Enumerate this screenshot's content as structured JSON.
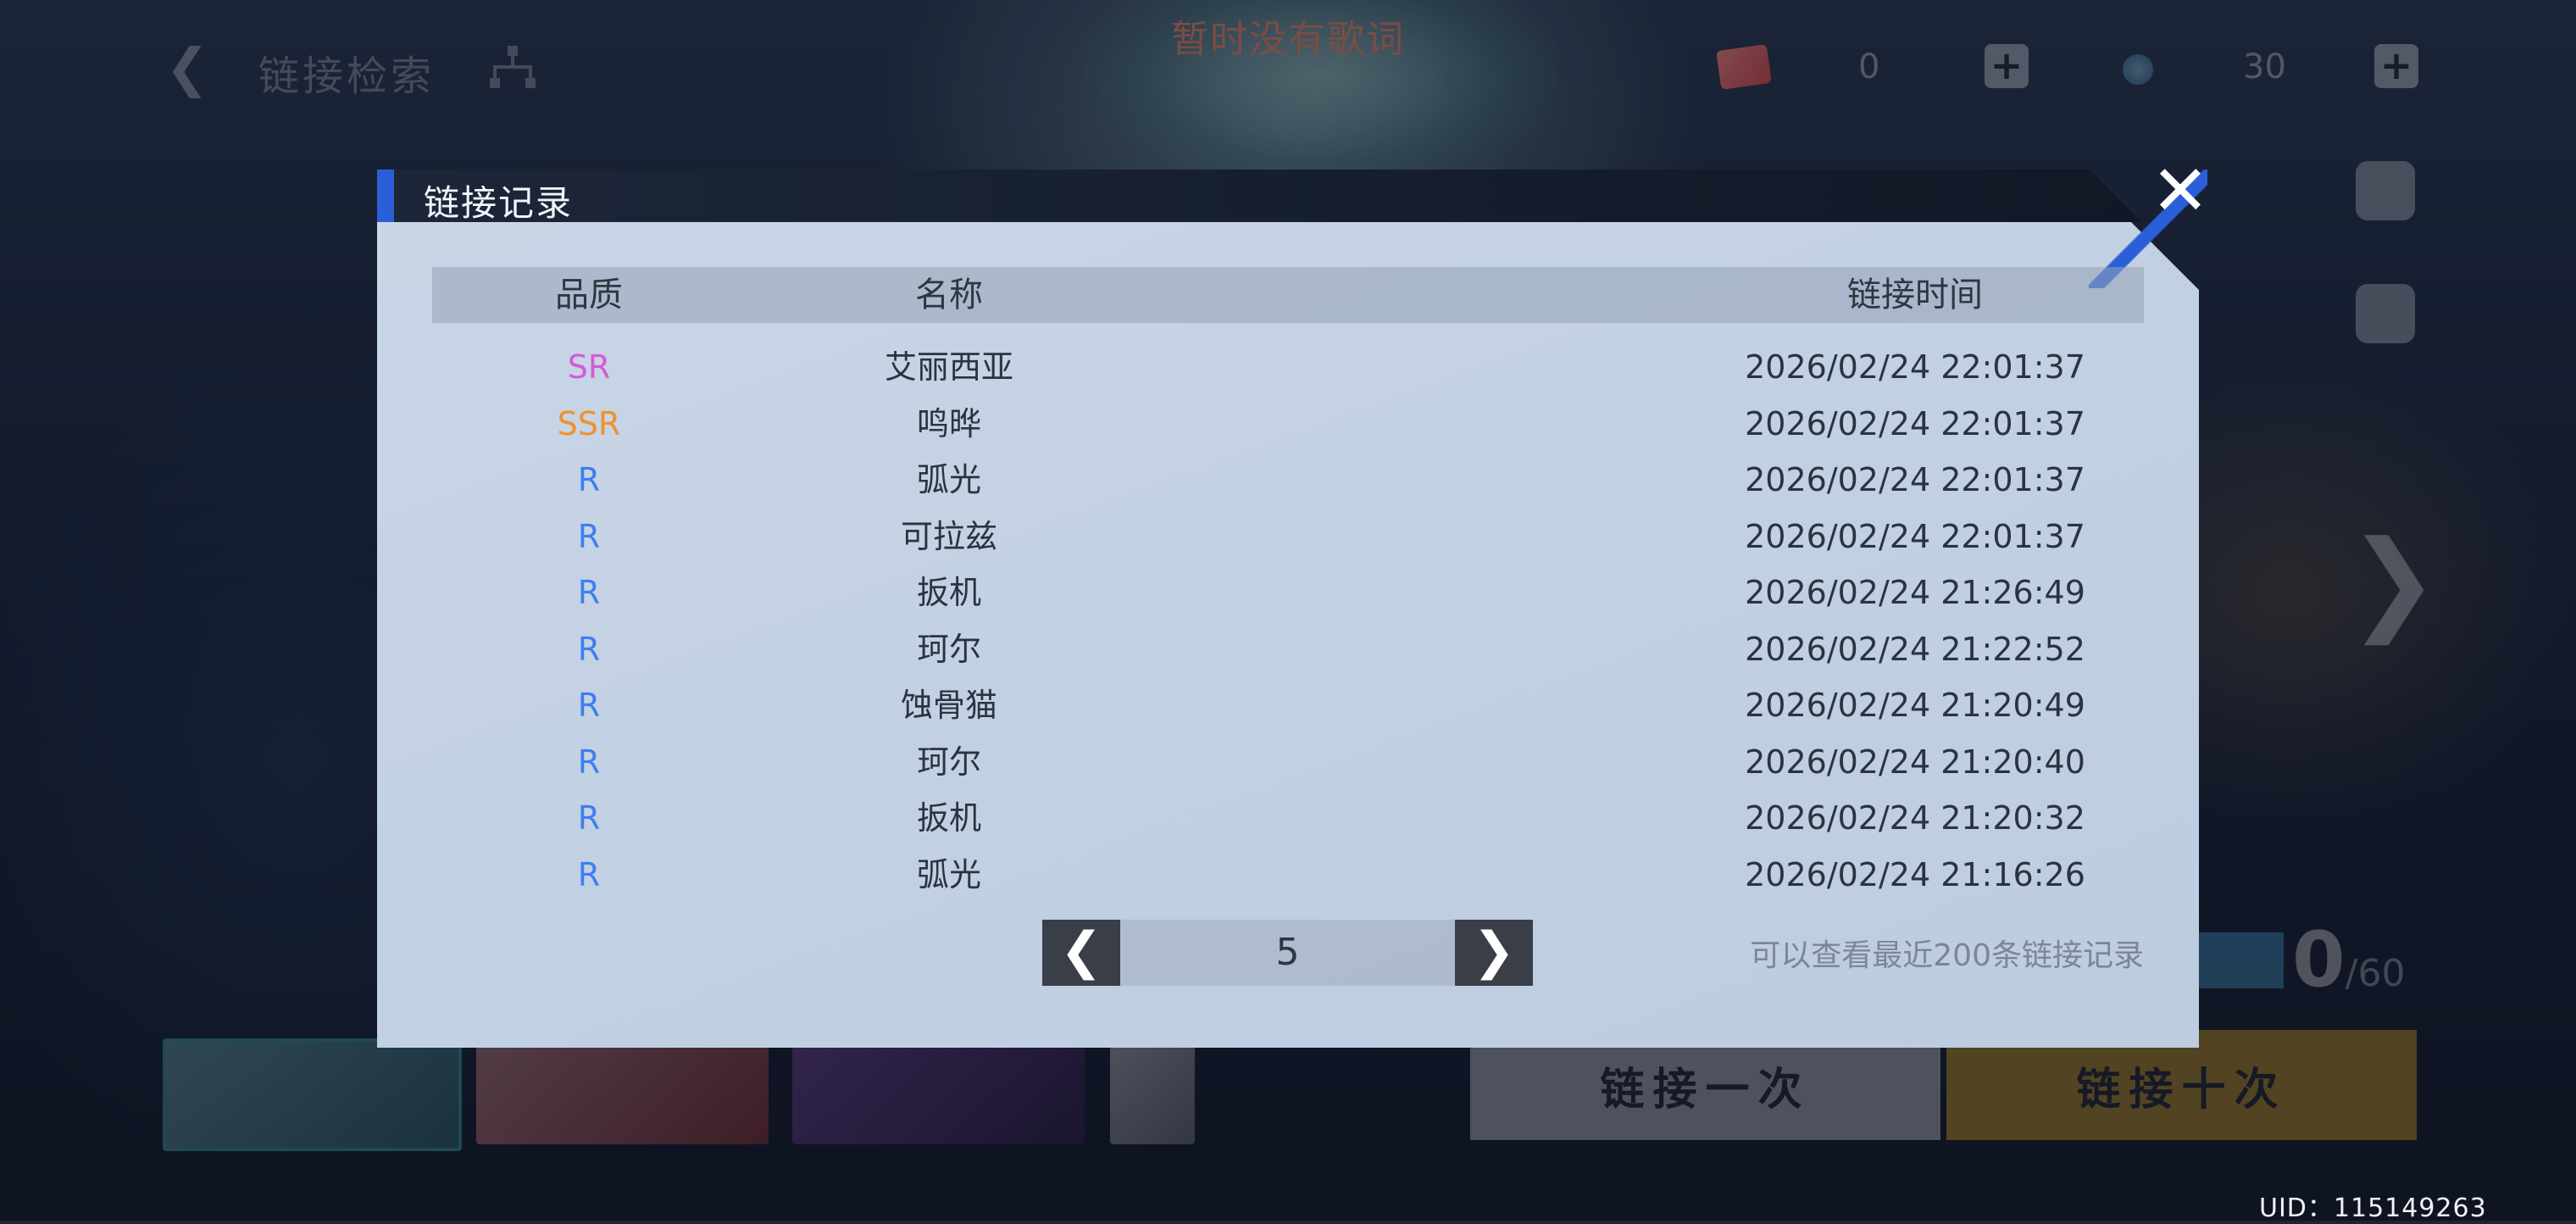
{
  "top_bar": {
    "back_icon": "chevron-left-icon",
    "title": "链接检索",
    "lyric": "暂时没有歌词",
    "currency_ticket_value": "0",
    "currency_gem_value": "30"
  },
  "dialog": {
    "title": "链接记录",
    "columns": {
      "quality": "品质",
      "name": "名称",
      "time": "链接时间"
    },
    "rows": [
      {
        "quality": "SR",
        "name": "艾丽西亚",
        "time": "2026/02/24 22:01:37"
      },
      {
        "quality": "SSR",
        "name": "鸣晔",
        "time": "2026/02/24 22:01:37"
      },
      {
        "quality": "R",
        "name": "弧光",
        "time": "2026/02/24 22:01:37"
      },
      {
        "quality": "R",
        "name": "可拉兹",
        "time": "2026/02/24 22:01:37"
      },
      {
        "quality": "R",
        "name": "扳机",
        "time": "2026/02/24 21:26:49"
      },
      {
        "quality": "R",
        "name": "珂尔",
        "time": "2026/02/24 21:22:52"
      },
      {
        "quality": "R",
        "name": "蚀骨猫",
        "time": "2026/02/24 21:20:49"
      },
      {
        "quality": "R",
        "name": "珂尔",
        "time": "2026/02/24 21:20:40"
      },
      {
        "quality": "R",
        "name": "扳机",
        "time": "2026/02/24 21:20:32"
      },
      {
        "quality": "R",
        "name": "弧光",
        "time": "2026/02/24 21:16:26"
      }
    ],
    "pager": {
      "page": "5",
      "prev_icon": "chevron-left-icon",
      "next_icon": "chevron-right-icon"
    },
    "hint": "可以查看最近200条链接记录",
    "quality_colors": {
      "SR": "#d45bd9",
      "SSR": "#f0922c",
      "R": "#3d7ff0"
    }
  },
  "background": {
    "pull_once": "链接一次",
    "pull_ten": "链接十次",
    "pity_count": "0",
    "pity_max": "/60"
  },
  "uid": "UID：115149263"
}
